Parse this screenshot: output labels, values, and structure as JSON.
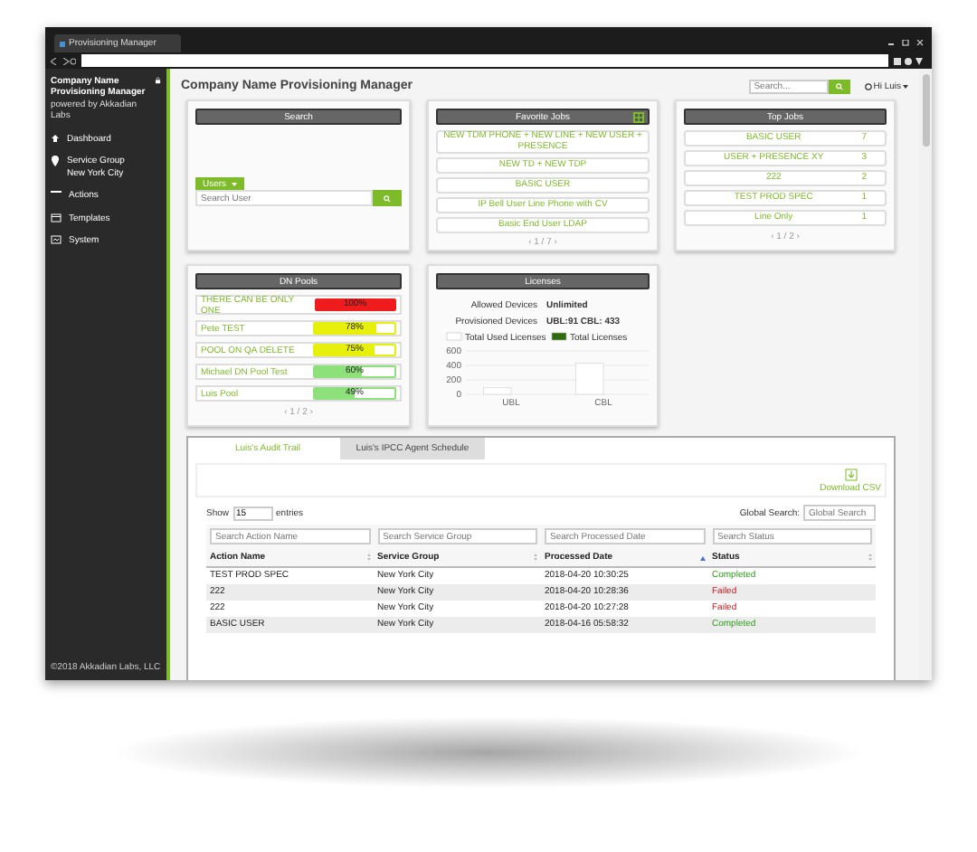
{
  "browser": {
    "tab_title": "Provisioning Manager"
  },
  "sidebar": {
    "brand": "Company Name Provisioning Manager",
    "powered_by": "powered by Akkadian Labs",
    "items": [
      {
        "label": "Dashboard",
        "kind": "home"
      },
      {
        "label": "Service Group",
        "sublabel": "New York City",
        "kind": "pin"
      },
      {
        "label": "Actions",
        "kind": "dots"
      },
      {
        "label": "Templates",
        "kind": "template"
      },
      {
        "label": "System",
        "kind": "system"
      }
    ],
    "footer": "©2018 Akkadian Labs, LLC"
  },
  "header": {
    "title": "Company Name Provisioning Manager",
    "search_placeholder": "Search...",
    "user": "Hi Luis"
  },
  "search_card": {
    "title": "Search",
    "scope": "Users",
    "placeholder": "Search User"
  },
  "favorite_jobs": {
    "title": "Favorite Jobs",
    "items": [
      "NEW TDM PHONE + NEW LINE + NEW USER + PRESENCE",
      "NEW TD + NEW TDP",
      "BASIC USER",
      "IP Bell User Line Phone with CV",
      "Basic End User LDAP"
    ],
    "pager": "‹ 1 / 7 ›"
  },
  "top_jobs": {
    "title": "Top Jobs",
    "items": [
      {
        "name": "BASIC USER",
        "count": "7"
      },
      {
        "name": "USER + PRESENCE XY",
        "count": "3"
      },
      {
        "name": "222",
        "count": "2"
      },
      {
        "name": "TEST PROD SPEC",
        "count": "1"
      },
      {
        "name": "Line Only",
        "count": "1"
      }
    ],
    "pager": "‹ 1 / 2 ›"
  },
  "dn_pools": {
    "title": "DN Pools",
    "pools": [
      {
        "name": "THERE CAN BE ONLY ONE",
        "level": 1.0,
        "reading": "100%"
      },
      {
        "name": "Pete TEST",
        "level": 0.78,
        "reading": "78%"
      },
      {
        "name": "POOL ON QA DELETE",
        "level": 0.75,
        "reading": "75%"
      },
      {
        "name": "Michael DN Pool Test",
        "level": 0.6,
        "reading": "60%"
      },
      {
        "name": "Luis Pool",
        "level": 0.49,
        "reading": "49%"
      }
    ],
    "pager": "‹ 1 / 2 ›"
  },
  "licenses": {
    "title": "Licenses",
    "rows": [
      {
        "label": "Allowed Devices",
        "value": "Unlimited"
      },
      {
        "label": "Provisioned Devices",
        "value": "UBL:91 CBL: 433"
      }
    ],
    "chart_data": {
      "type": "bar",
      "categories": [
        "UBL",
        "CBL"
      ],
      "series": [
        {
          "name": "Total Used Licenses",
          "color": "#ffffff",
          "values": [
            90,
            430
          ]
        },
        {
          "name": "Total Licenses",
          "color": "#2e6b0f",
          "values": [
            null,
            null
          ]
        }
      ],
      "ylim": [
        0,
        600
      ],
      "yticks": [
        0,
        200,
        400,
        600
      ]
    }
  },
  "audit": {
    "tabs": [
      {
        "label": "Luis's Audit Trail",
        "selected": true
      },
      {
        "label": "Luis's IPCC Agent Schedule",
        "selected": false
      }
    ],
    "download": "Download CSV",
    "show": "Show",
    "page_size": "15",
    "entries": "entries",
    "global_search_label": "Global Search:",
    "global_search_placeholder": "Global Search",
    "columns": [
      {
        "title": "Action Name",
        "placeholder": "Search Action Name",
        "sorted": false
      },
      {
        "title": "Service Group",
        "placeholder": "Search Service Group",
        "sorted": false
      },
      {
        "title": "Processed Date",
        "placeholder": "Search Processed Date",
        "sorted": true
      },
      {
        "title": "Status",
        "placeholder": "Search Status",
        "sorted": false
      }
    ],
    "rows": [
      {
        "action": "TEST PROD SPEC",
        "group": "New York City",
        "date": "2018-04-20 10:30:25",
        "status": "Completed",
        "kind": "ok"
      },
      {
        "action": "222",
        "group": "New York City",
        "date": "2018-04-20 10:28:36",
        "status": "Failed",
        "kind": "fail"
      },
      {
        "action": "222",
        "group": "New York City",
        "date": "2018-04-20 10:27:28",
        "status": "Failed",
        "kind": "fail"
      },
      {
        "action": "BASIC USER",
        "group": "New York City",
        "date": "2018-04-16 05:58:32",
        "status": "Completed",
        "kind": "ok"
      }
    ]
  }
}
